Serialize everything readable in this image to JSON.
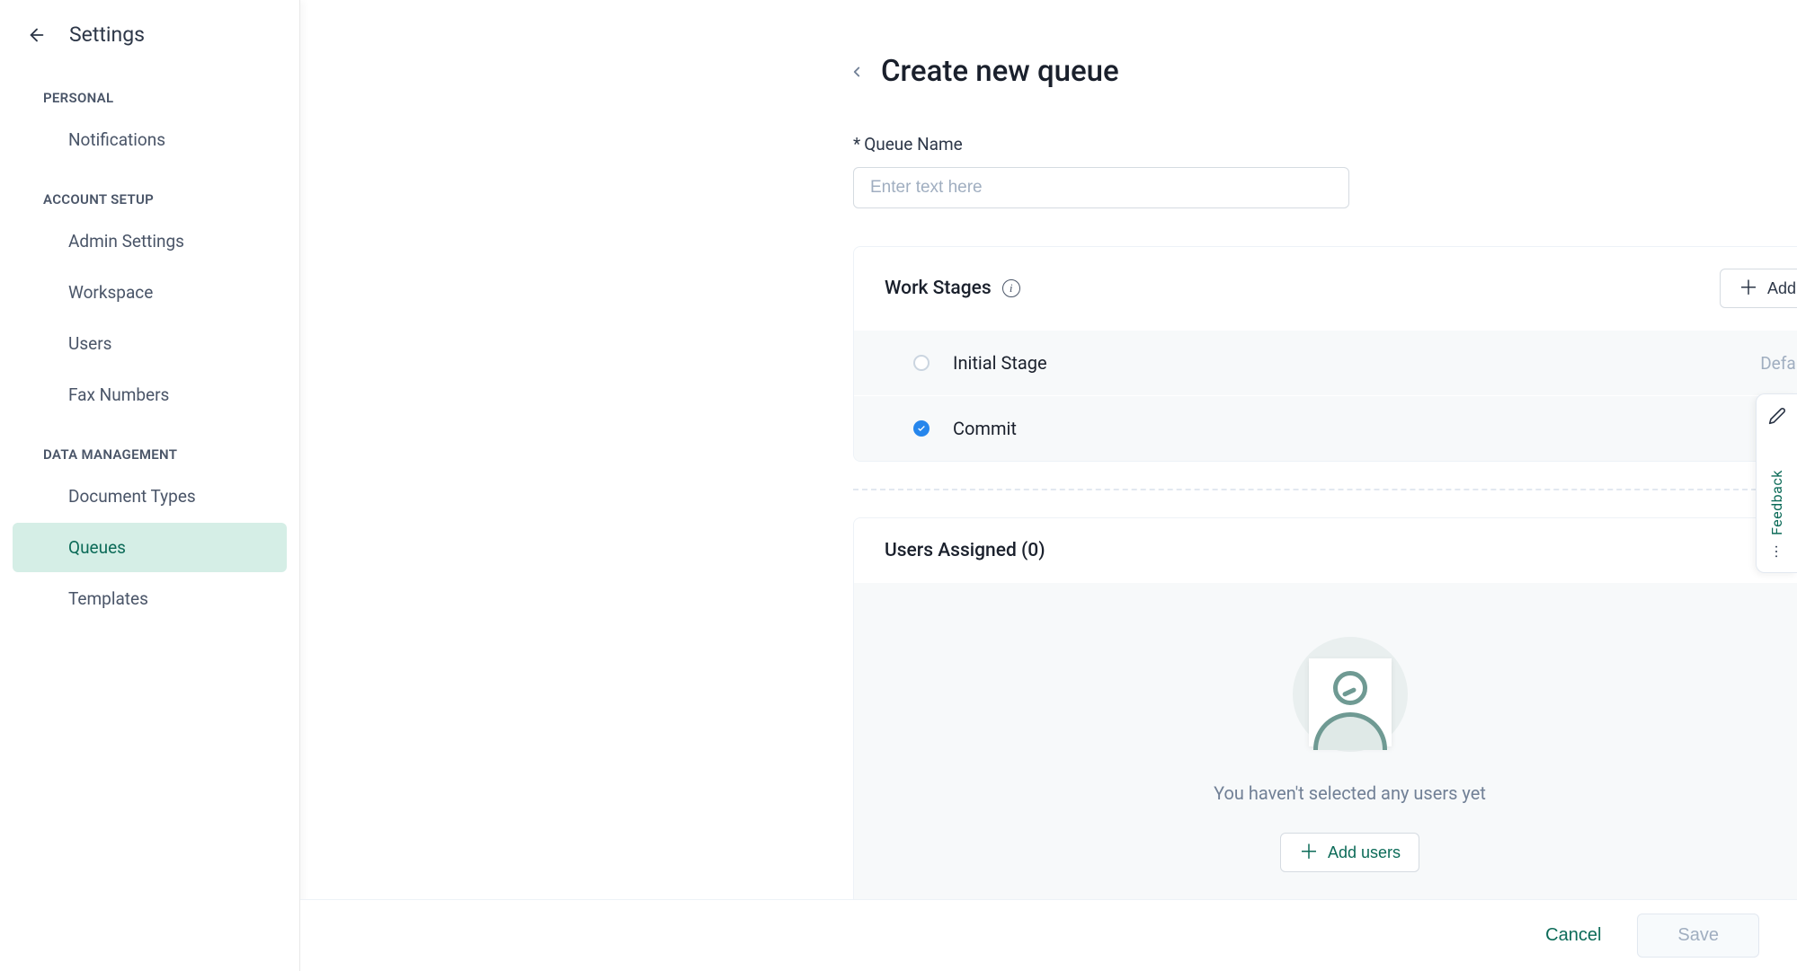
{
  "sidebar": {
    "title": "Settings",
    "sections": [
      {
        "label": "PERSONAL",
        "items": [
          {
            "label": "Notifications",
            "active": false
          }
        ]
      },
      {
        "label": "ACCOUNT SETUP",
        "items": [
          {
            "label": "Admin Settings",
            "active": false
          },
          {
            "label": "Workspace",
            "active": false
          },
          {
            "label": "Users",
            "active": false
          },
          {
            "label": "Fax Numbers",
            "active": false
          }
        ]
      },
      {
        "label": "DATA MANAGEMENT",
        "items": [
          {
            "label": "Document Types",
            "active": false
          },
          {
            "label": "Queues",
            "active": true
          },
          {
            "label": "Templates",
            "active": false
          }
        ]
      }
    ]
  },
  "page": {
    "title": "Create new queue",
    "queue_name_label": "Queue Name",
    "queue_name_placeholder": "Enter text here",
    "queue_name_value": ""
  },
  "work_stages": {
    "title": "Work Stages",
    "add_label": "Add",
    "stages": [
      {
        "name": "Initial Stage",
        "tag": "Default",
        "checked": false
      },
      {
        "name": "Commit",
        "tag": "",
        "checked": true
      }
    ]
  },
  "users": {
    "title": "Users Assigned (0)",
    "empty_text": "You haven't selected any users yet",
    "add_users_label": "Add users"
  },
  "footer": {
    "cancel_label": "Cancel",
    "save_label": "Save"
  },
  "feedback": {
    "label": "Feedback"
  }
}
